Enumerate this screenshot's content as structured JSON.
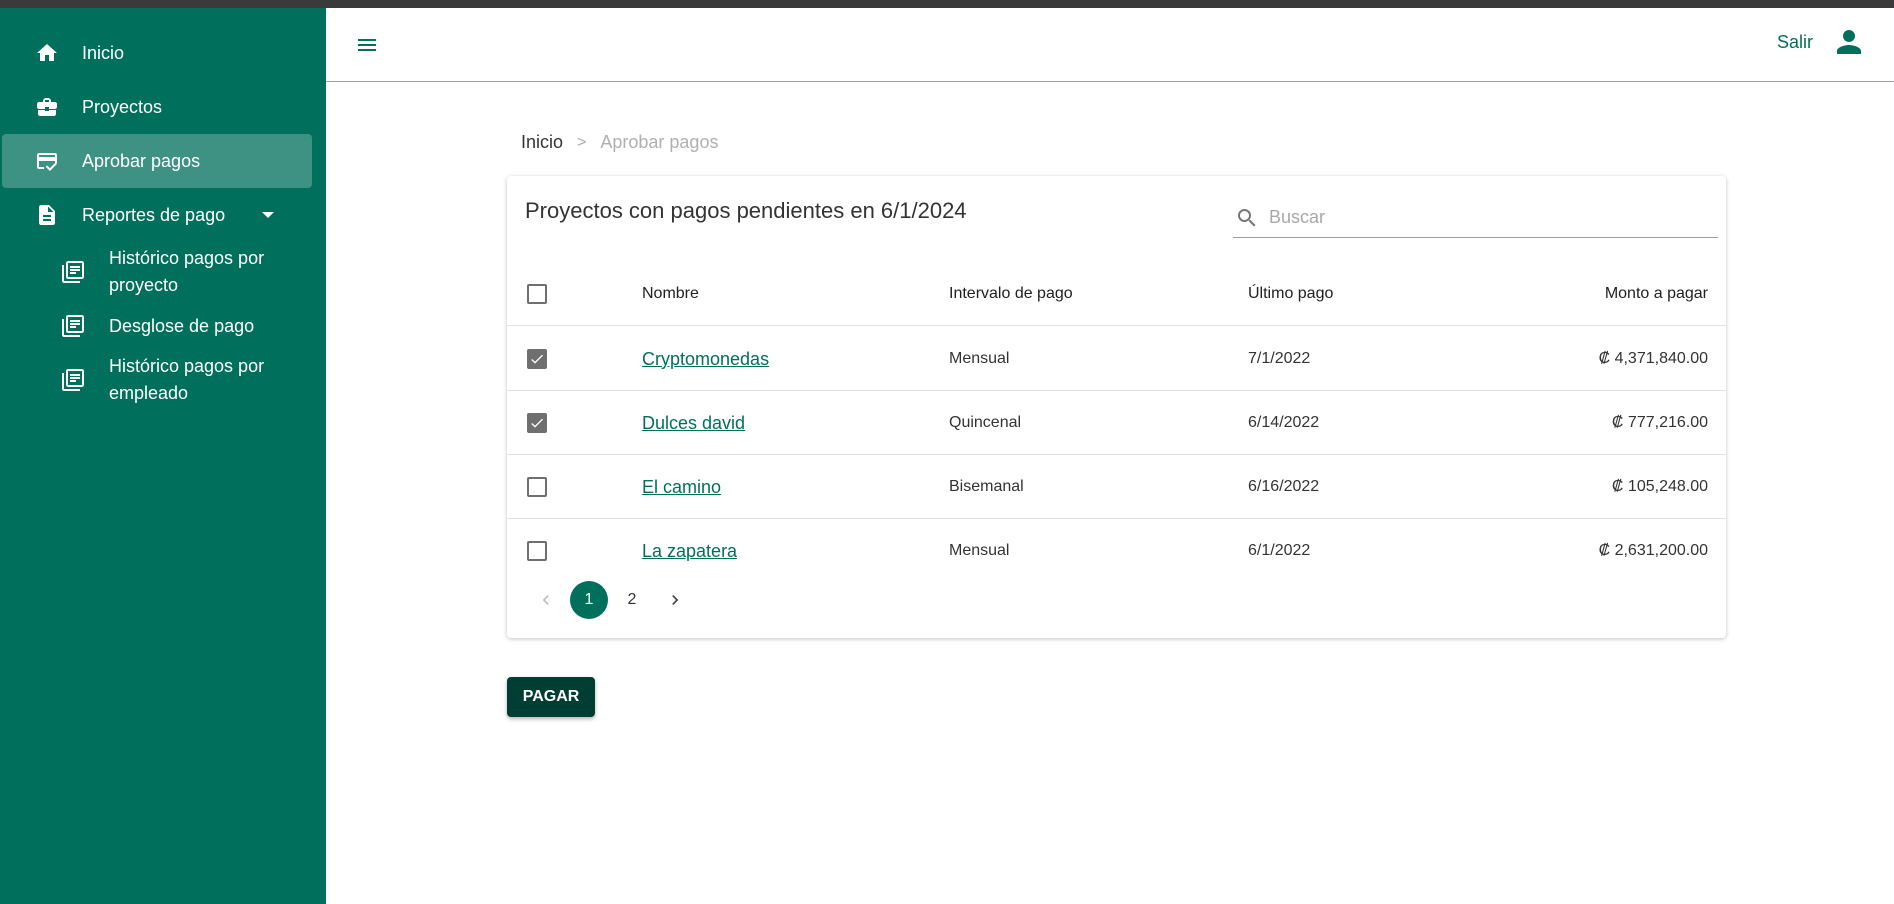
{
  "sidebar": {
    "items": [
      {
        "icon": "home-icon",
        "label": "Inicio"
      },
      {
        "icon": "briefcase-icon",
        "label": "Proyectos"
      },
      {
        "icon": "payment-check-icon",
        "label": "Aprobar pagos",
        "active": true
      },
      {
        "icon": "document-icon",
        "label": "Reportes de pago",
        "expanded": true
      }
    ],
    "subitems": [
      {
        "icon": "list-document-icon",
        "label": "Histórico pagos por proyecto"
      },
      {
        "icon": "list-document-icon",
        "label": "Desglose de pago"
      },
      {
        "icon": "list-document-icon",
        "label": "Histórico pagos por empleado"
      }
    ]
  },
  "header": {
    "logout_label": "Salir",
    "menu_icon": "hamburger-menu-icon",
    "user_icon": "account-icon"
  },
  "breadcrumb": {
    "home": "Inicio",
    "separator": ">",
    "current": "Aprobar pagos"
  },
  "card": {
    "title": "Proyectos con pagos pendientes en 6/1/2024",
    "search_placeholder": "Buscar",
    "search_value": ""
  },
  "table": {
    "columns": {
      "name": "Nombre",
      "interval": "Intervalo de pago",
      "last_payment": "Último pago",
      "amount": "Monto a pagar"
    },
    "rows": [
      {
        "checked": true,
        "name": "Cryptomonedas",
        "interval": "Mensual",
        "last_payment": "7/1/2022",
        "amount": "₡ 4,371,840.00"
      },
      {
        "checked": true,
        "name": "Dulces david",
        "interval": "Quincenal",
        "last_payment": "6/14/2022",
        "amount": "₡ 777,216.00"
      },
      {
        "checked": false,
        "name": "El camino",
        "interval": "Bisemanal",
        "last_payment": "6/16/2022",
        "amount": "₡ 105,248.00"
      },
      {
        "checked": false,
        "name": "La zapatera",
        "interval": "Mensual",
        "last_payment": "6/1/2022",
        "amount": "₡ 2,631,200.00"
      }
    ]
  },
  "pagination": {
    "pages": [
      "1",
      "2"
    ],
    "current": "1"
  },
  "actions": {
    "pay_label": "PAGAR"
  },
  "colors": {
    "brand": "#00705d",
    "brand_dark": "#003d33",
    "checkbox": "#6f6f6f"
  }
}
